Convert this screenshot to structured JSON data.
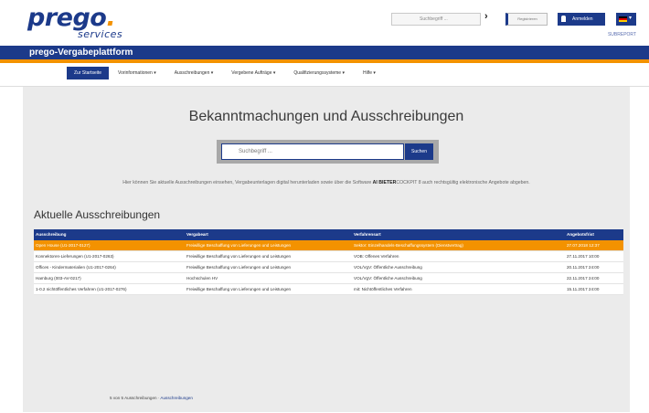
{
  "logo": {
    "main": "prego",
    "dot": ".",
    "sub": "services"
  },
  "header": {
    "search_placeholder": "Suchbegriff ...",
    "go": "›",
    "register_label": "Registrieren",
    "login_label": "Anmelden",
    "language": "de",
    "small_logo": "SUBREPORT"
  },
  "titlebar": {
    "title": "prego-Vergabeplattform"
  },
  "nav": {
    "items": [
      {
        "label": "Zur Startseite"
      },
      {
        "label": "Vorinformationen ▾"
      },
      {
        "label": "Ausschreibungen ▾"
      },
      {
        "label": "Vergebene Aufträge ▾"
      },
      {
        "label": "Qualifizierungssysteme ▾"
      },
      {
        "label": "Hilfe ▾"
      }
    ]
  },
  "main": {
    "heading": "Bekanntmachungen und Ausschreibungen",
    "search_placeholder": "Suchbegriff ...",
    "search_button": "Suchen",
    "info_before": "Hier können Sie aktuelle Ausschreibungen einsehen, Vergabeunterlagen digital herunterladen sowie über die Software ",
    "info_bold": "AI BIETER",
    "info_after": "COCKPIT 8 auch rechtsgültig elektronische Angebote abgeben.",
    "section_title": "Aktuelle Ausschreibungen"
  },
  "table": {
    "columns": [
      "Ausschreibung",
      "Vergabeart",
      "Verfahrensart",
      "Angebotsfrist"
    ],
    "rows": [
      [
        "Open House (U1-2017-0127)",
        "Freiwillige Beschaffung von Lieferungen und Leistungen",
        "Sektor: Einzelhandels-Beschaffungssystem (Dienstvertrag)",
        "27.07.2018 12:37"
      ],
      [
        "Konnektoren-Lieferungen (U1-2017-0263)",
        "Freiwillige Beschaffung von Lieferungen und Leistungen",
        "VOB: Offenes Verfahren",
        "27.11.2017 10:00"
      ],
      [
        "Offices - Kindermaterialien (U1-2017-0264)",
        "Freiwillige Beschaffung von Lieferungen und Leistungen",
        "VOL/VgV: Öffentliche Ausschreibung",
        "20.11.2017 24:00"
      ],
      [
        "Hamburg (003-AV-0217)",
        "Hochschulen HV",
        "VOL/VgV: Öffentliche Ausschreibung",
        "22.11.2017 24:00"
      ],
      [
        "1-0.2 nichtöffentliches Verfahren (U1-2017-0276)",
        "Freiwillige Beschaffung von Lieferungen und Leistungen",
        "mit: Nichtöffentliches Verfahren",
        "15.11.2017 24:00"
      ]
    ]
  },
  "footer": {
    "count": "5 von 5 Ausschreibungen · ",
    "link": "Ausschreibungen"
  },
  "colors": {
    "brand": "#1c3a8a",
    "accent": "#f39200"
  }
}
